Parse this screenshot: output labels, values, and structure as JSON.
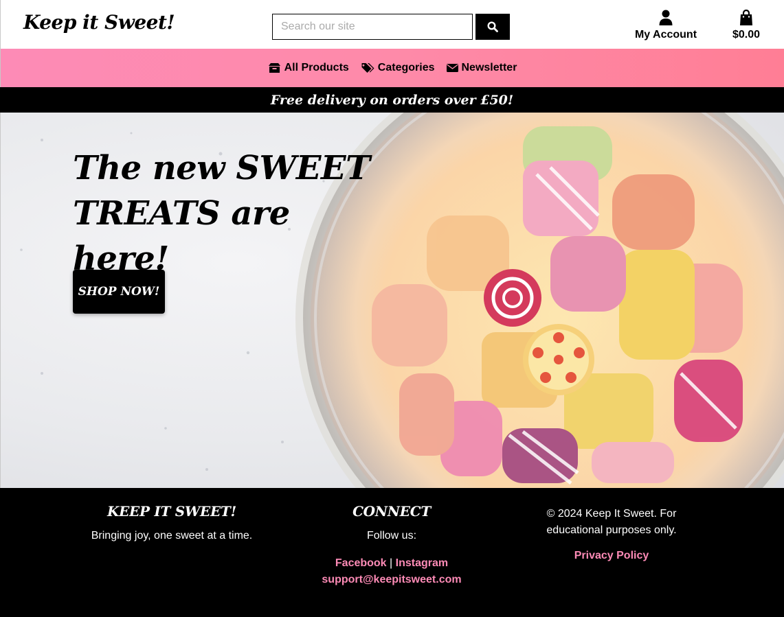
{
  "header": {
    "logo": "Keep it Sweet!",
    "search_placeholder": "Search our site",
    "account_label": "My Account",
    "cart_total": "$0.00"
  },
  "nav": {
    "items": [
      {
        "label": "All Products",
        "icon": "box-icon"
      },
      {
        "label": "Categories",
        "icon": "tags-icon"
      },
      {
        "label": "Newsletter",
        "icon": "envelope-icon"
      }
    ]
  },
  "promo": {
    "text": "Free delivery on orders over £50!"
  },
  "hero": {
    "title_line1": "The new SWEET",
    "title_line2": "TREATS are here!",
    "cta": "SHOP NOW!"
  },
  "footer": {
    "brand_heading": "KEEP IT SWEET!",
    "tagline": "Bringing joy, one sweet at a time.",
    "connect_heading": "CONNECT",
    "follow_text": "Follow us:",
    "facebook": "Facebook",
    "separator": "|",
    "instagram": "Instagram",
    "email": "support@keepitsweet.com",
    "copyright_line1": "© 2024 Keep It Sweet. For",
    "copyright_line2": "educational purposes only.",
    "privacy": "Privacy Policy"
  },
  "colors": {
    "nav_pink": "#fd8bb6",
    "accent_pink": "#ff7e95",
    "black": "#000000"
  }
}
